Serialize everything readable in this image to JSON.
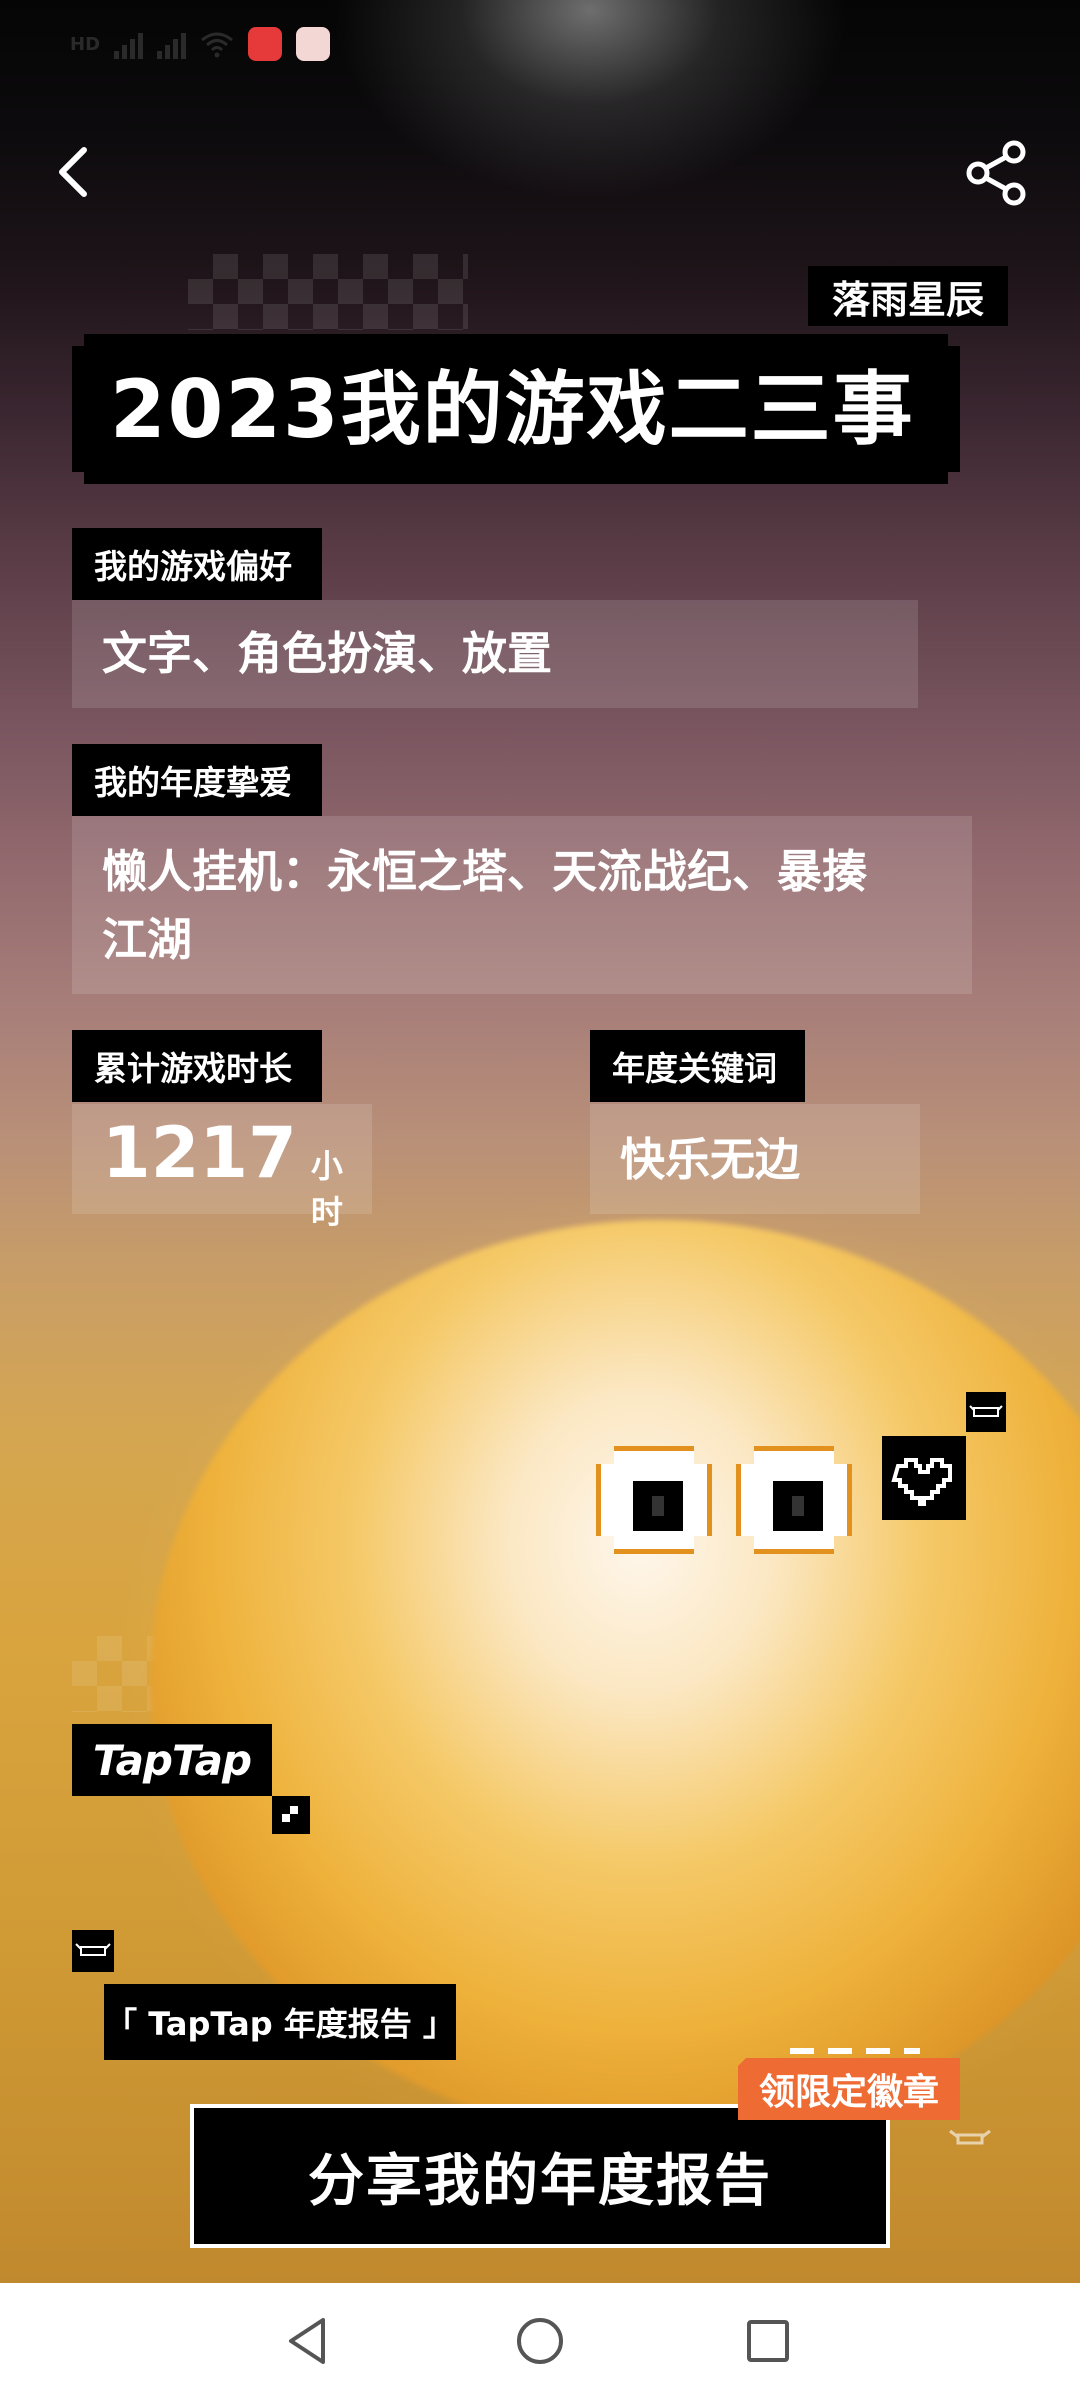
{
  "status_bar": {
    "carrier_left": "HD",
    "signal1": "4G",
    "signal2": "4G",
    "icons": [
      "wifi-icon",
      "huawei-appgallery-icon",
      "gift-box-icon"
    ]
  },
  "header": {
    "back_icon": "chevron-left-icon",
    "share_icon": "share-icon",
    "username": "落雨星辰"
  },
  "report": {
    "title": "2023我的游戏二三事",
    "preference": {
      "label": "我的游戏偏好",
      "value": "文字、角色扮演、放置"
    },
    "favorite": {
      "label": "我的年度挚爱",
      "value_line1": "懒人挂机：永恒之塔、天流战纪、暴揍",
      "value_line2": "江湖"
    },
    "playtime": {
      "label": "累计游戏时长",
      "value": "1217",
      "unit": "小时"
    },
    "keyword": {
      "label": "年度关键词",
      "value": "快乐无边"
    }
  },
  "branding": {
    "logo": "TapTap",
    "tag": "「 TapTap 年度报告 」"
  },
  "cta": {
    "badge": "领限定徽章",
    "button": "分享我的年度报告"
  },
  "nav": {
    "back": "triangle-back-icon",
    "home": "circle-home-icon",
    "recents": "square-recents-icon"
  },
  "colors": {
    "accent_badge": "#ef6b34",
    "panel_black": "#000000",
    "eye_outline": "#e2901e"
  }
}
